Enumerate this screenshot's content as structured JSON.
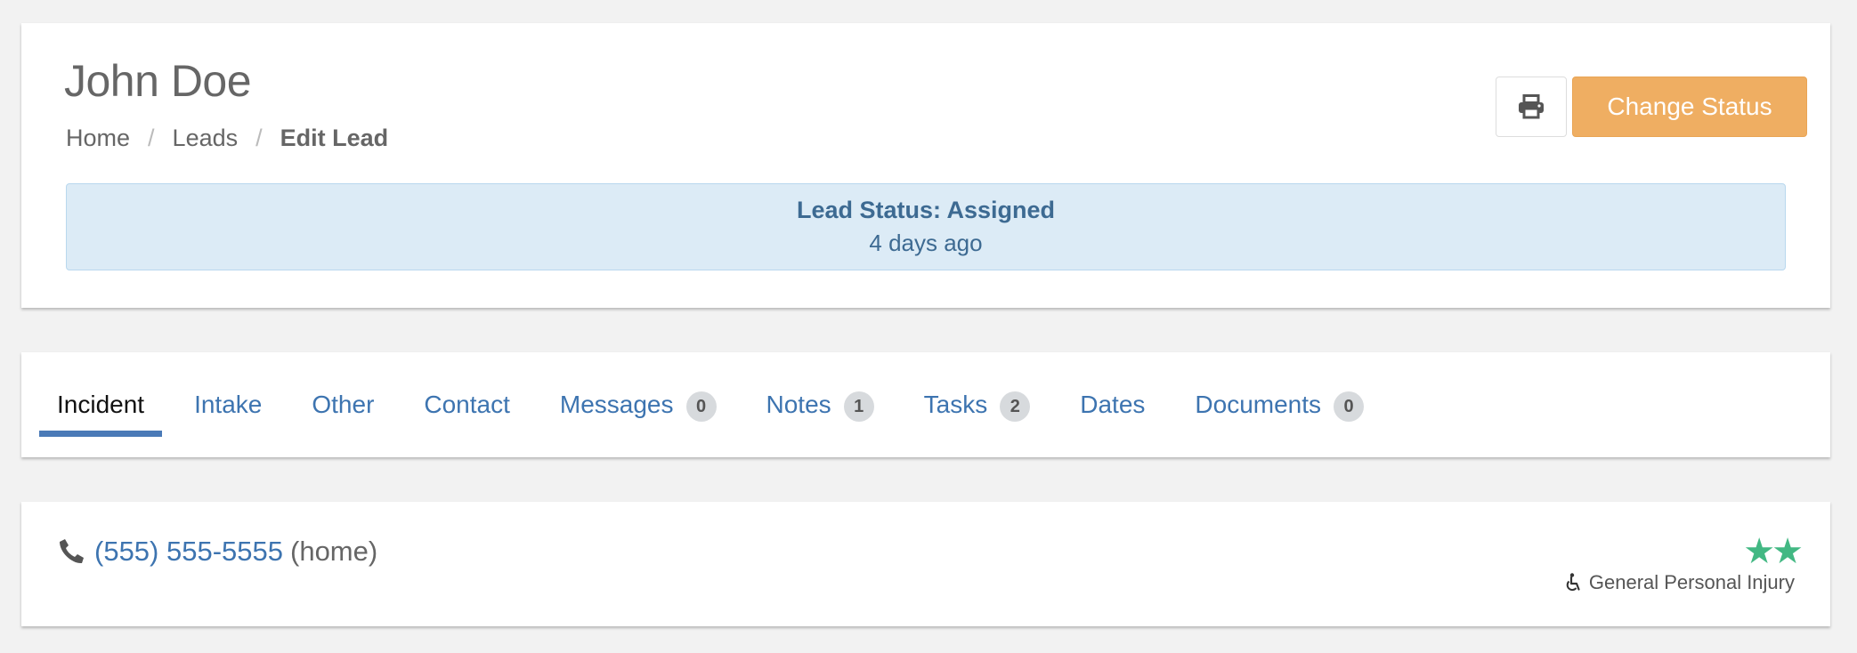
{
  "header": {
    "title": "John Doe",
    "breadcrumb": [
      "Home",
      "Leads",
      "Edit Lead"
    ],
    "change_status_label": "Change Status",
    "print_icon": "print-icon",
    "lead_status_label": "Lead Status: Assigned",
    "lead_status_time": "4 days ago"
  },
  "tabs": [
    {
      "label": "Incident",
      "active": true
    },
    {
      "label": "Intake"
    },
    {
      "label": "Other"
    },
    {
      "label": "Contact"
    },
    {
      "label": "Messages",
      "badge": "0"
    },
    {
      "label": "Notes",
      "badge": "1"
    },
    {
      "label": "Tasks",
      "badge": "2"
    },
    {
      "label": "Dates"
    },
    {
      "label": "Documents",
      "badge": "0"
    }
  ],
  "contact": {
    "phone": "(555) 555-5555",
    "phone_type": "(home)",
    "phone_icon": "phone-icon",
    "rating": 2,
    "case_type": "General Personal Injury",
    "case_icon": "wheelchair-icon"
  },
  "colors": {
    "accent": "#3d74b0",
    "status_button": "#efae62",
    "alert_bg": "#dcebf6",
    "star": "#42b883"
  }
}
